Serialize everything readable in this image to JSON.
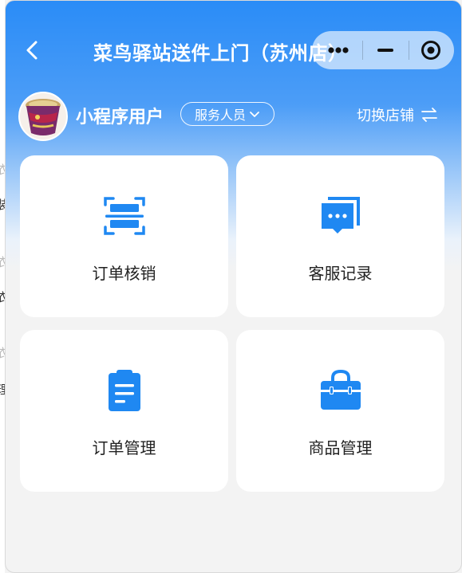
{
  "header": {
    "title": "菜鸟驿站送件上门（苏州店）",
    "back_icon": "chevron-left-icon",
    "capsule": {
      "more_icon": "more-dots-icon",
      "minimize_icon": "minimize-icon",
      "close_icon": "target-circle-icon"
    }
  },
  "profile": {
    "username": "小程序用户",
    "role": "服务人员",
    "switch_store": "切换店铺"
  },
  "cards": [
    {
      "label": "订单核销",
      "icon": "scan-icon"
    },
    {
      "label": "客服记录",
      "icon": "chat-icon"
    },
    {
      "label": "订单管理",
      "icon": "clipboard-icon"
    },
    {
      "label": "商品管理",
      "icon": "bag-icon"
    }
  ],
  "background_page": {
    "fragments": [
      "衣",
      "装",
      "衣",
      "衣",
      "衣",
      "理"
    ]
  },
  "colors": {
    "accent": "#2a8cf7",
    "icon_blue": "#1f88f2",
    "background": "#f3f3f3"
  }
}
